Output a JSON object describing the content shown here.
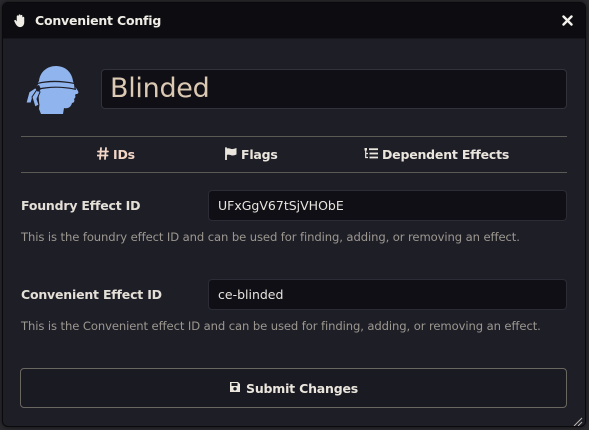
{
  "window": {
    "title": "Convenient Config",
    "title_icon": "hand-icon",
    "close_icon": "close-icon"
  },
  "effect": {
    "name": "Blinded",
    "icon": "blindfolded-head-icon"
  },
  "tabs": [
    {
      "label": "IDs",
      "icon": "hashtag-icon",
      "active": true
    },
    {
      "label": "Flags",
      "icon": "flag-icon",
      "active": false
    },
    {
      "label": "Dependent Effects",
      "icon": "list-tree-icon",
      "active": false
    }
  ],
  "fields": {
    "foundry": {
      "label": "Foundry Effect ID",
      "value": "UFxGgV67tSjVHObE",
      "hint": "This is the foundry effect ID and can be used for finding, adding, or removing an effect."
    },
    "convenient": {
      "label": "Convenient Effect ID",
      "value": "ce-blinded",
      "hint": "This is the Convenient effect ID and can be used for finding, adding, or removing an effect."
    }
  },
  "submit": {
    "label": "Submit Changes",
    "icon": "save-icon"
  },
  "colors": {
    "window_bg": "#1e1e27",
    "titlebar_bg": "#0d0d11",
    "input_bg": "#0f0f15",
    "active_tab": "#f2d6c6",
    "icon_blue": "#8fb4ee"
  }
}
